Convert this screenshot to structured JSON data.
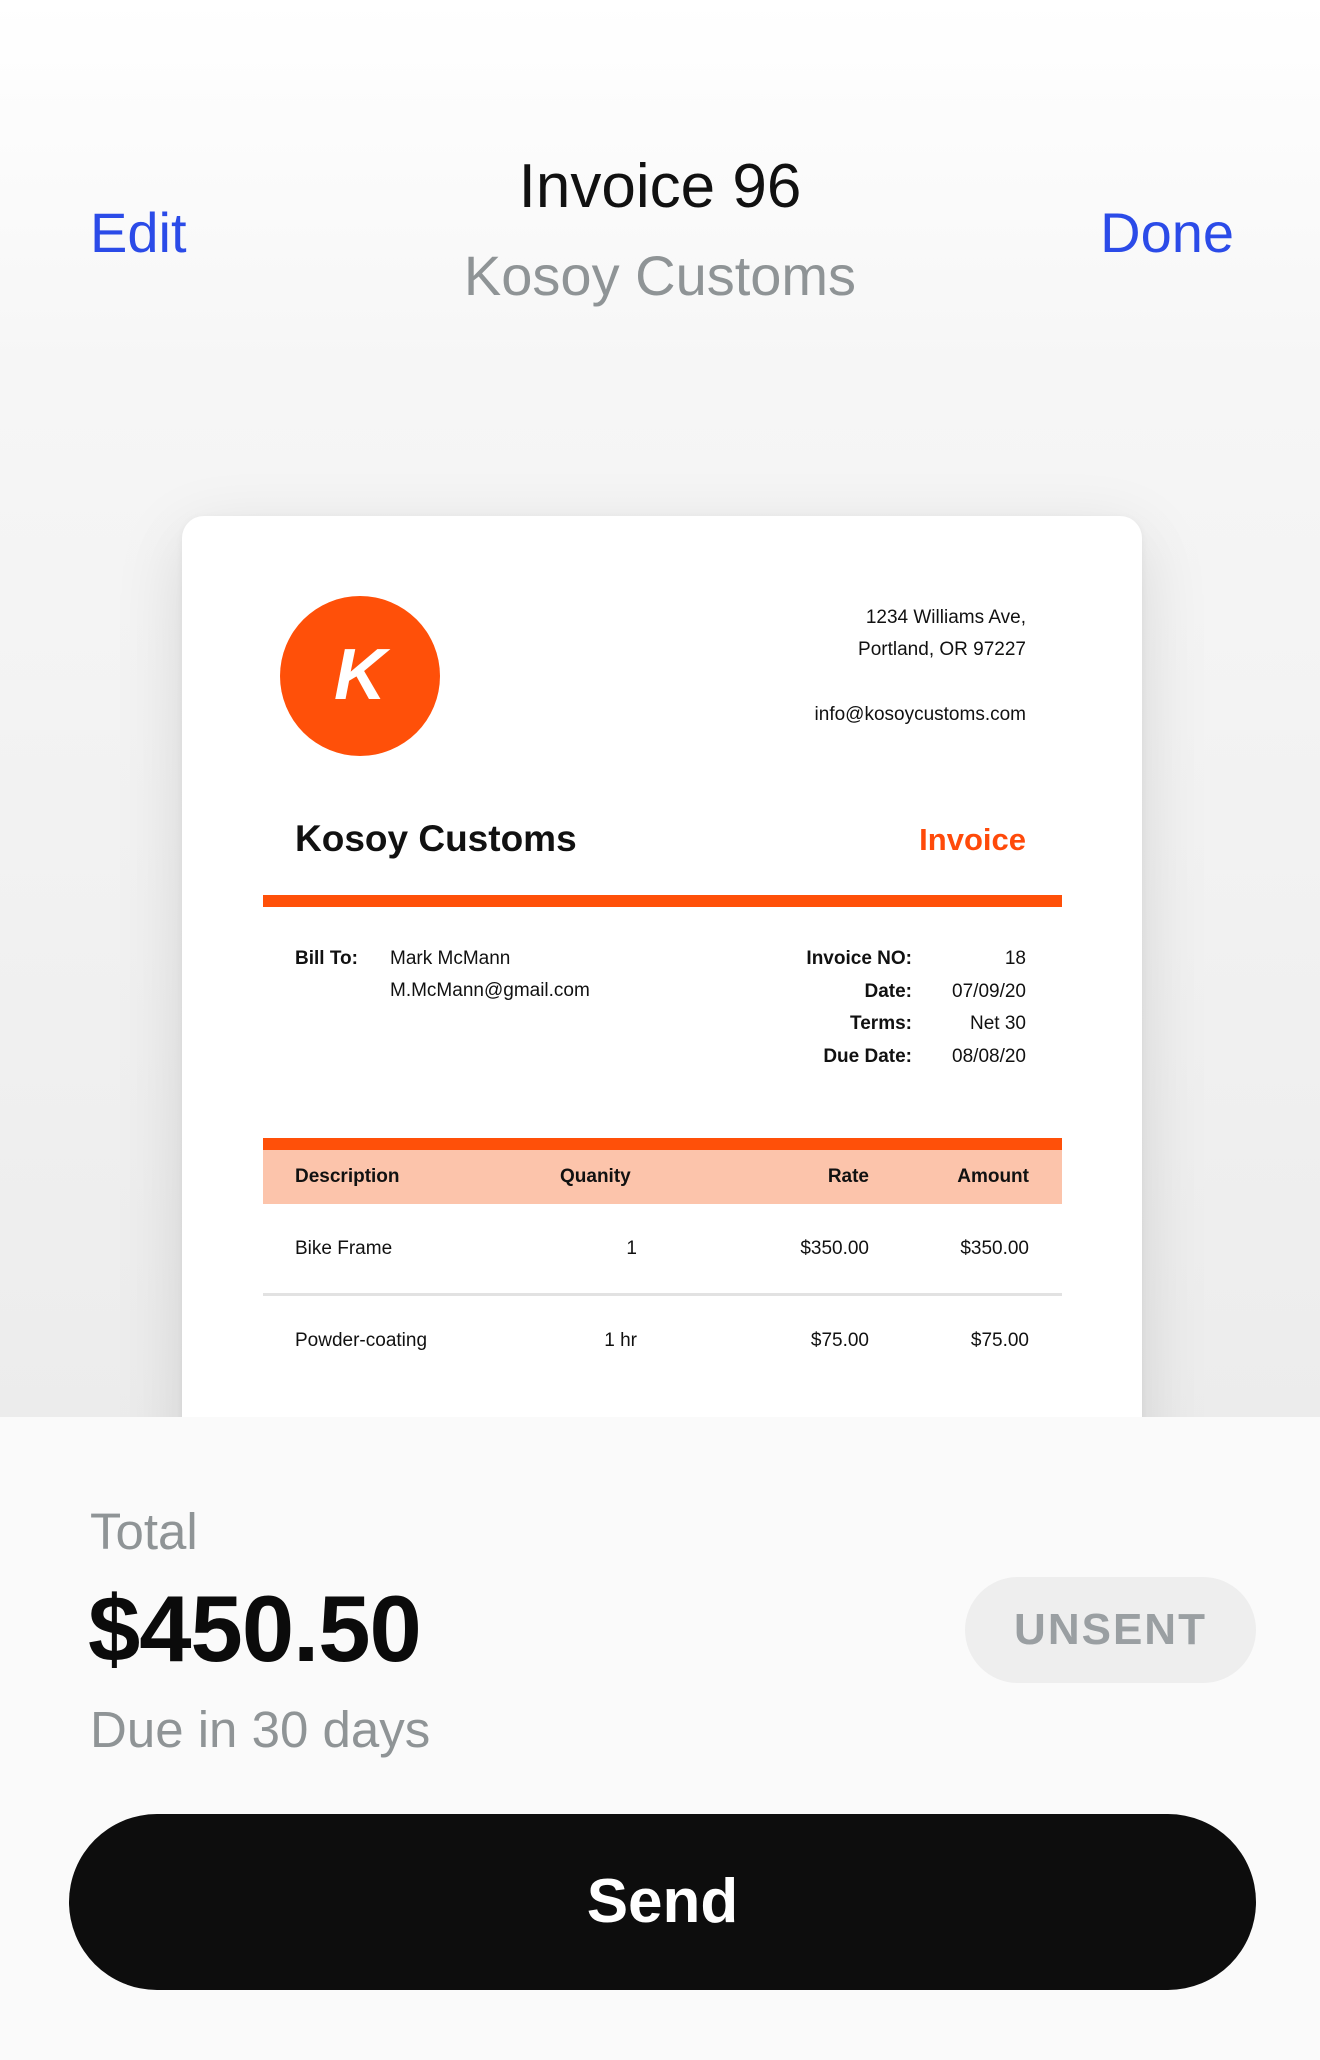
{
  "header": {
    "edit_label": "Edit",
    "done_label": "Done",
    "title": "Invoice 96",
    "subtitle": "Kosoy Customs"
  },
  "invoice": {
    "logo_letter": "K",
    "address_line_1": "1234 Williams Ave,",
    "address_line_2": "Portland, OR 97227",
    "email": "info@kosoycustoms.com",
    "company_name": "Kosoy Customs",
    "doc_label": "Invoice",
    "bill_to_label": "Bill To:",
    "bill_to_name": "Mark McMann",
    "bill_to_email": "M.McMann@gmail.com",
    "meta": {
      "invoice_no_label": "Invoice NO:",
      "invoice_no": "18",
      "date_label": "Date:",
      "date": "07/09/20",
      "terms_label": "Terms:",
      "terms": "Net 30",
      "due_date_label": "Due Date:",
      "due_date": "08/08/20"
    },
    "table": {
      "headers": {
        "description": "Description",
        "quantity": "Quanity",
        "rate": "Rate",
        "amount": "Amount"
      },
      "rows": [
        {
          "description": "Bike Frame",
          "quantity": "1",
          "rate": "$350.00",
          "amount": "$350.00"
        },
        {
          "description": "Powder-coating",
          "quantity": "1 hr",
          "rate": "$75.00",
          "amount": "$75.00"
        }
      ]
    },
    "accent_color": "#ff5009",
    "table_header_color": "#fcc4ab"
  },
  "summary": {
    "total_label": "Total",
    "total_amount": "$450.50",
    "due_text": "Due in 30 days",
    "status": "UNSENT",
    "send_label": "Send"
  },
  "colors": {
    "link": "#2b4be8",
    "muted": "#8f9496",
    "primary_button": "#0d0d0d"
  }
}
